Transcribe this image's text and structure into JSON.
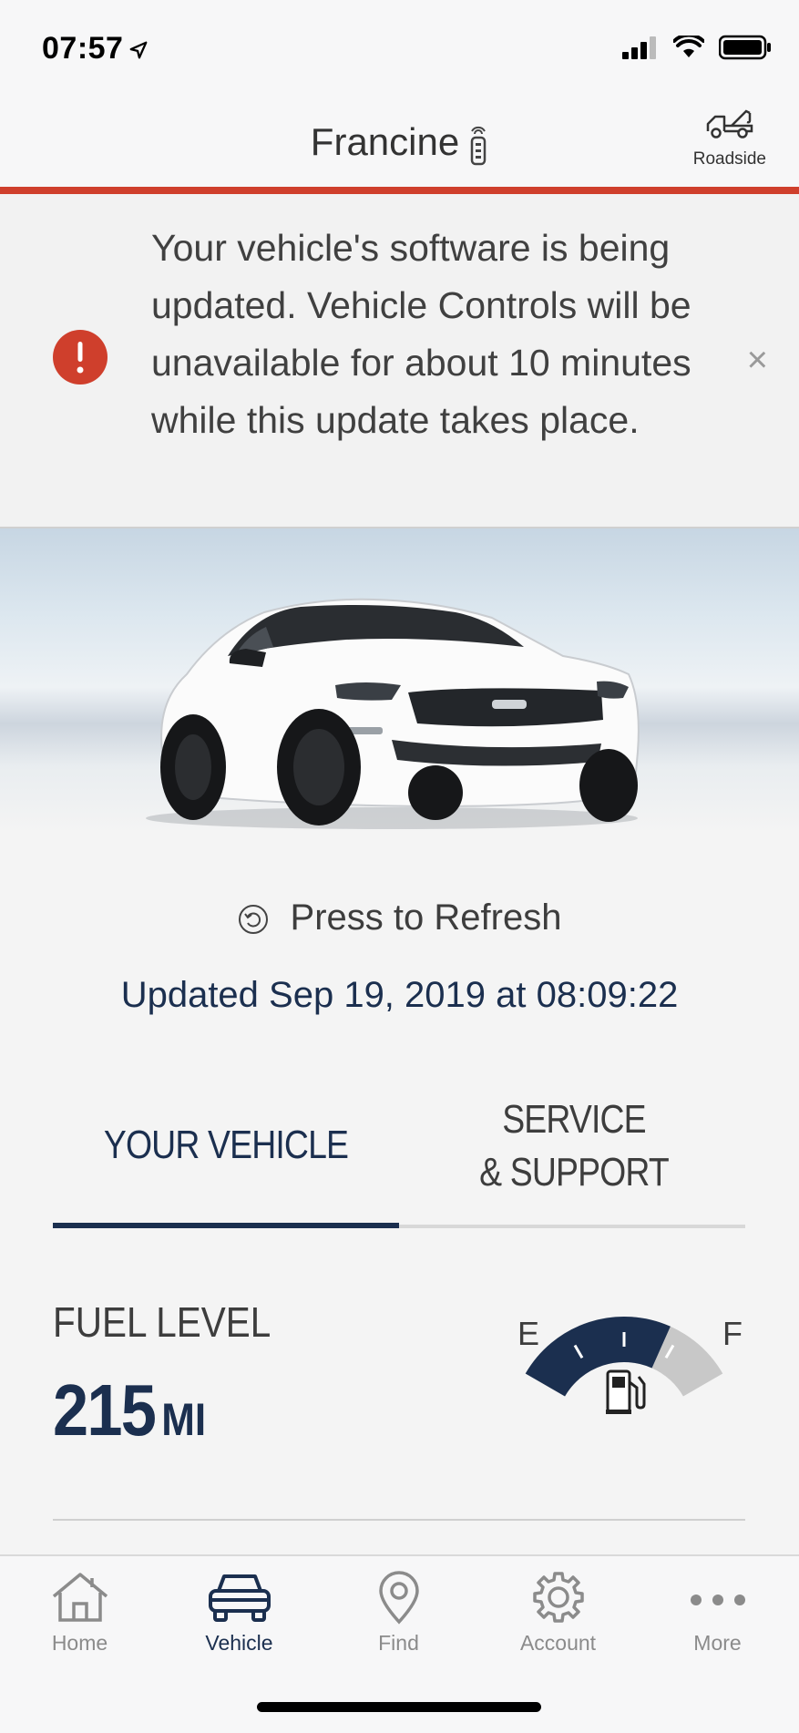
{
  "status_bar": {
    "time": "07:57"
  },
  "header": {
    "vehicle_name": "Francine",
    "roadside_label": "Roadside"
  },
  "alert": {
    "message": "Your vehicle's software is being updated. Vehicle Controls will be unavailable for about 10 minutes while this update takes place.",
    "icon": "exclamation-icon",
    "close": "×"
  },
  "refresh": {
    "label": "Press to Refresh",
    "updated": "Updated Sep 19, 2019 at 08:09:22"
  },
  "tabs": {
    "vehicle": "YOUR VEHICLE",
    "service_line1": "SERVICE",
    "service_line2": "& SUPPORT",
    "active": "vehicle"
  },
  "fuel": {
    "label": "FUEL LEVEL",
    "value": "215",
    "unit": "MI",
    "empty_label": "E",
    "full_label": "F",
    "level": 0.7
  },
  "nav": [
    {
      "label": "Home",
      "icon": "home-icon"
    },
    {
      "label": "Vehicle",
      "icon": "car-icon",
      "active": true
    },
    {
      "label": "Find",
      "icon": "location-pin-icon"
    },
    {
      "label": "Account",
      "icon": "gear-icon"
    },
    {
      "label": "More",
      "icon": "more-dots-icon"
    }
  ],
  "colors": {
    "accent": "#cf3f2c",
    "navy": "#1b2f4f",
    "gauge_empty": "#c8c8c8"
  }
}
